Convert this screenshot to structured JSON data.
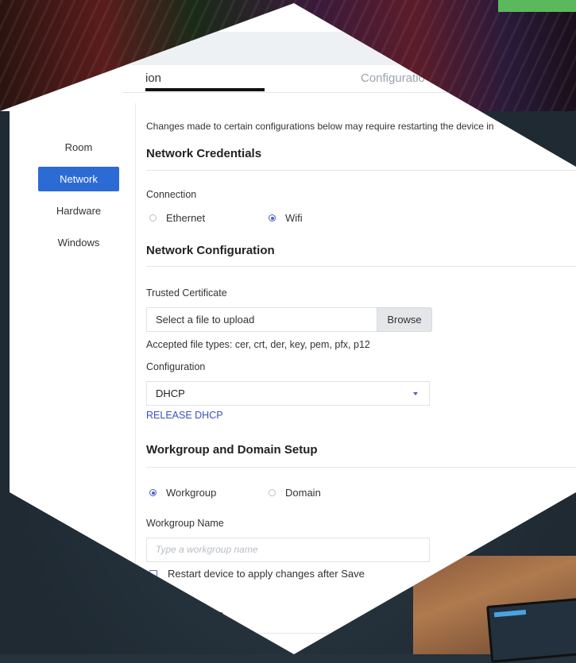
{
  "tabs": [
    {
      "label": "ion"
    },
    {
      "label": "Configuratio"
    }
  ],
  "sidebar": {
    "items": [
      {
        "label": "Room"
      },
      {
        "label": "Network"
      },
      {
        "label": "Hardware"
      },
      {
        "label": "Windows"
      }
    ],
    "active": "Network"
  },
  "notice": "Changes made to certain configurations below may require restarting the device in",
  "network_credentials": {
    "title": "Network Credentials",
    "connection_label": "Connection",
    "options": [
      "Ethernet",
      "Wifi"
    ],
    "selected": "Wifi"
  },
  "network_configuration": {
    "title": "Network Configuration",
    "cert_label": "Trusted Certificate",
    "file_placeholder": "Select a file to upload",
    "browse_label": "Browse",
    "accepted_types": "Accepted file types: cer, crt, der, key, pem, pfx, p12",
    "config_label": "Configuration",
    "config_value": "DHCP",
    "release_link": "RELEASE DHCP"
  },
  "workgroup": {
    "title": "Workgroup and Domain Setup",
    "options": [
      "Workgroup",
      "Domain"
    ],
    "selected": "Workgroup",
    "name_label": "Workgroup Name",
    "name_placeholder": "Type a workgroup name",
    "restart_label": "Restart device to apply changes after Save"
  },
  "next_section_title": "me",
  "colors": {
    "accent": "#2d6bd4",
    "radio": "#4a60c8",
    "link": "#3a52b8",
    "green_tab": "#5cb85c"
  }
}
